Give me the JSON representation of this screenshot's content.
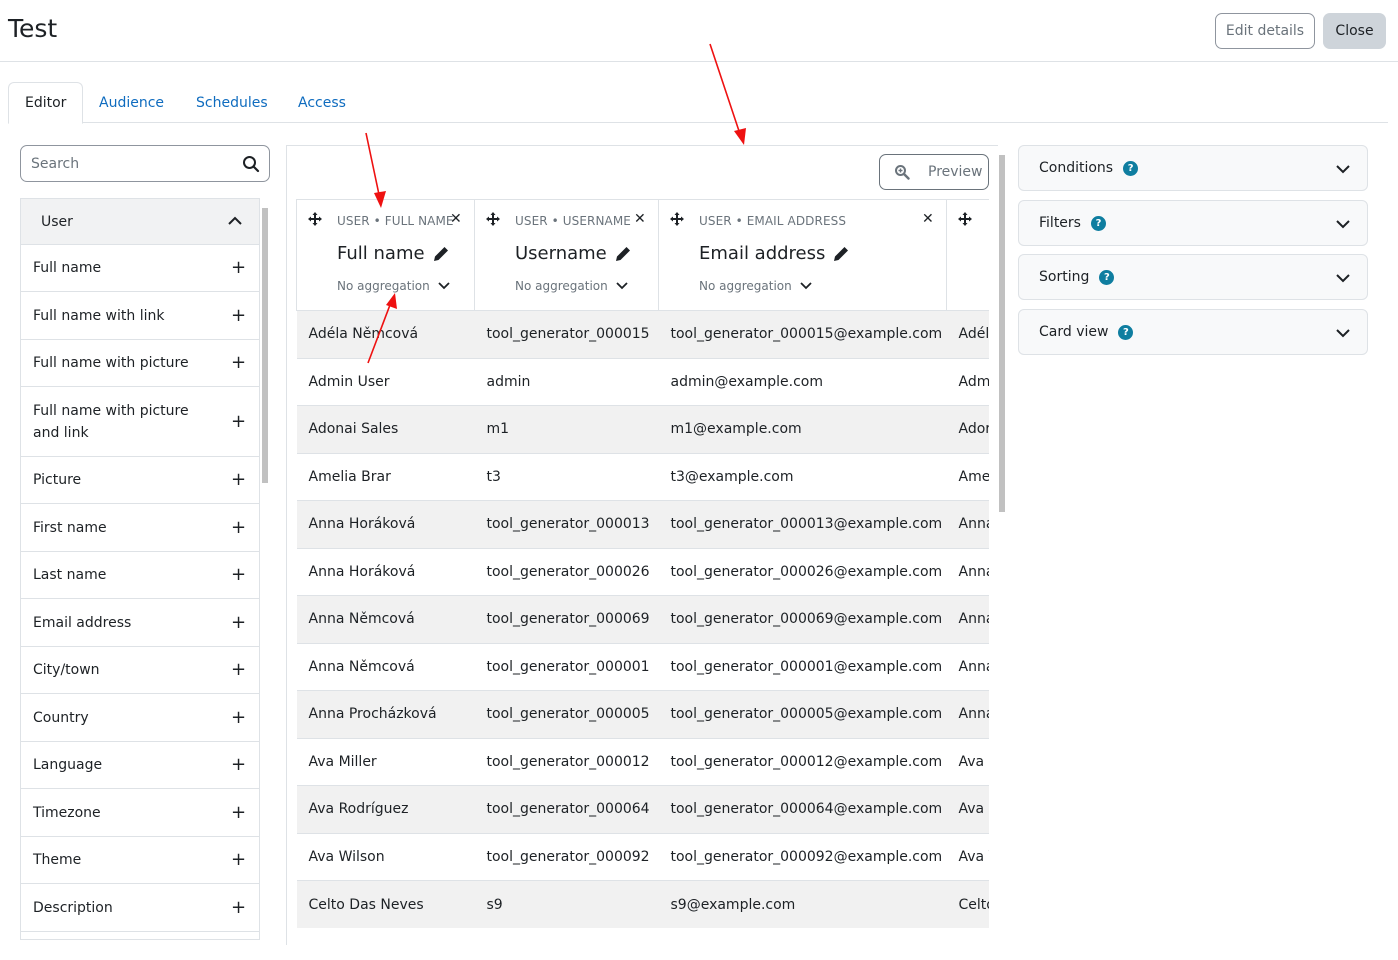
{
  "page": {
    "title": "Test",
    "edit_details": "Edit details",
    "close": "Close"
  },
  "tabs": [
    {
      "label": "Editor",
      "active": true
    },
    {
      "label": "Audience"
    },
    {
      "label": "Schedules"
    },
    {
      "label": "Access"
    }
  ],
  "search": {
    "placeholder": "Search"
  },
  "sidebar": {
    "group": "User",
    "items": [
      {
        "label": "Full name"
      },
      {
        "label": "Full name with link"
      },
      {
        "label": "Full name with picture"
      },
      {
        "label": "Full name with picture and link"
      },
      {
        "label": "Picture"
      },
      {
        "label": "First name"
      },
      {
        "label": "Last name"
      },
      {
        "label": "Email address"
      },
      {
        "label": "City/town"
      },
      {
        "label": "Country"
      },
      {
        "label": "Language"
      },
      {
        "label": "Timezone"
      },
      {
        "label": "Theme"
      },
      {
        "label": "Description"
      }
    ]
  },
  "preview": {
    "label": "Preview"
  },
  "columns": [
    {
      "category": "USER • FULL NAME",
      "name": "Full name",
      "aggregation": "No aggregation"
    },
    {
      "category": "USER • USERNAME",
      "name": "Username",
      "aggregation": "No aggregation"
    },
    {
      "category": "USER • EMAIL ADDRESS",
      "name": "Email address",
      "aggregation": "No aggregation"
    }
  ],
  "rows": [
    [
      "Adéla Němcová",
      "tool_generator_000015",
      "tool_generator_000015@example.com",
      "Adél"
    ],
    [
      "Admin User",
      "admin",
      "admin@example.com",
      "Adm"
    ],
    [
      "Adonai Sales",
      "m1",
      "m1@example.com",
      "Ador"
    ],
    [
      "Amelia Brar",
      "t3",
      "t3@example.com",
      "Ame"
    ],
    [
      "Anna Horáková",
      "tool_generator_000013",
      "tool_generator_000013@example.com",
      "Anna"
    ],
    [
      "Anna Horáková",
      "tool_generator_000026",
      "tool_generator_000026@example.com",
      "Anna"
    ],
    [
      "Anna Němcová",
      "tool_generator_000069",
      "tool_generator_000069@example.com",
      "Anna"
    ],
    [
      "Anna Němcová",
      "tool_generator_000001",
      "tool_generator_000001@example.com",
      "Anna"
    ],
    [
      "Anna Procházková",
      "tool_generator_000005",
      "tool_generator_000005@example.com",
      "Anna"
    ],
    [
      "Ava Miller",
      "tool_generator_000012",
      "tool_generator_000012@example.com",
      "Ava I"
    ],
    [
      "Ava Rodríguez",
      "tool_generator_000064",
      "tool_generator_000064@example.com",
      "Ava I"
    ],
    [
      "Ava Wilson",
      "tool_generator_000092",
      "tool_generator_000092@example.com",
      "Ava V"
    ],
    [
      "Celto Das Neves",
      "s9",
      "s9@example.com",
      "Celto"
    ]
  ],
  "panels": [
    {
      "label": "Conditions"
    },
    {
      "label": "Filters"
    },
    {
      "label": "Sorting"
    },
    {
      "label": "Card view"
    }
  ],
  "icons": {
    "help": "?"
  }
}
